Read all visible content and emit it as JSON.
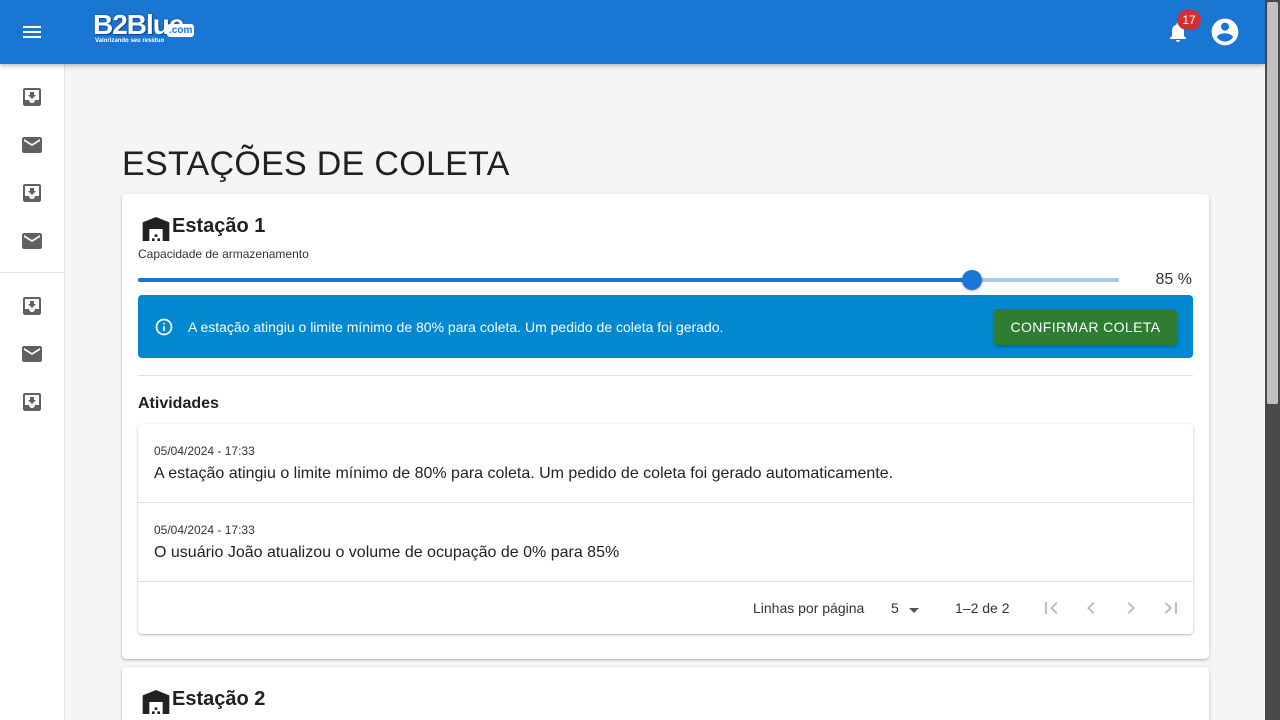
{
  "header": {
    "logo_text": "B2Blue",
    "logo_domain": ".com",
    "logo_tagline": "Valorizando seu resíduo",
    "notification_count": "17"
  },
  "sidebar": {
    "items": [
      {
        "icon": "move-to-inbox-icon"
      },
      {
        "icon": "mail-icon"
      },
      {
        "icon": "move-to-inbox-icon"
      },
      {
        "icon": "mail-icon"
      },
      {
        "icon": "move-to-inbox-icon"
      },
      {
        "icon": "mail-icon"
      },
      {
        "icon": "move-to-inbox-icon"
      }
    ]
  },
  "page": {
    "title": "ESTAÇÕES DE COLETA"
  },
  "stations": [
    {
      "name": "Estação 1",
      "capacity_label": "Capacidade de armazenamento",
      "capacity_value": 85,
      "capacity_text": "85 %",
      "alert": {
        "text": "A estação atingiu o limite mínimo de 80% para coleta. Um pedido de coleta foi gerado.",
        "button": "CONFIRMAR COLETA"
      },
      "activities_title": "Atividades",
      "activities": [
        {
          "date": "05/04/2024 - 17:33",
          "text": "A estação atingiu o limite mínimo de 80% para coleta. Um pedido de coleta foi gerado automaticamente."
        },
        {
          "date": "05/04/2024 - 17:33",
          "text": "O usuário João atualizou o volume de ocupação de 0% para 85%"
        }
      ],
      "pagination": {
        "rows_label": "Linhas por página",
        "rows_value": "5",
        "range": "1–2 de 2"
      }
    },
    {
      "name": "Estação 2"
    }
  ],
  "colors": {
    "appbar": "#1976d2",
    "alert": "#0288d1",
    "confirm_button": "#2e7d32",
    "badge": "#d32f2f"
  }
}
